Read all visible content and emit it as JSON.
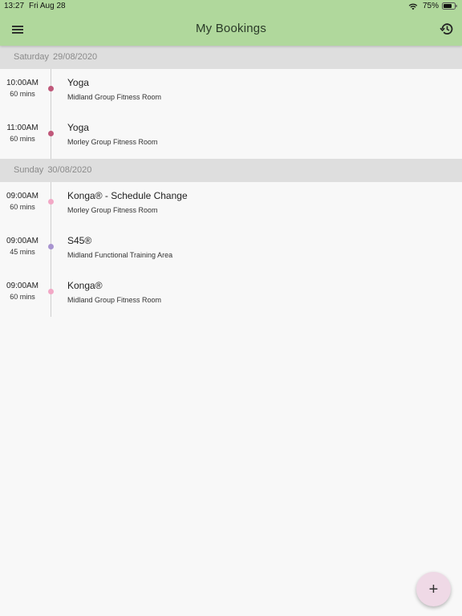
{
  "status_bar": {
    "time": "13:27",
    "date": "Fri Aug 28",
    "battery": "75%",
    "wifi_icon": "wifi-icon",
    "battery_icon": "battery-icon"
  },
  "header": {
    "title": "My Bookings",
    "menu_icon": "hamburger-menu-icon",
    "history_icon": "history-icon",
    "background": "#b0d89c"
  },
  "days": [
    {
      "weekday": "Saturday",
      "date": "29/08/2020",
      "bookings": [
        {
          "time": "10:00AM",
          "duration": "60 mins",
          "name": "Yoga",
          "location": "Midland Group Fitness Room",
          "dot_color": "#c0587a"
        },
        {
          "time": "11:00AM",
          "duration": "60 mins",
          "name": "Yoga",
          "location": "Morley Group Fitness Room",
          "dot_color": "#c0587a"
        }
      ]
    },
    {
      "weekday": "Sunday",
      "date": "30/08/2020",
      "bookings": [
        {
          "time": "09:00AM",
          "duration": "60 mins",
          "name": "Konga® - Schedule Change",
          "location": "Morley Group Fitness Room",
          "dot_color": "#f2a8c6"
        },
        {
          "time": "09:00AM",
          "duration": "45 mins",
          "name": "S45®",
          "location": "Midland Functional Training Area",
          "dot_color": "#a894d0"
        },
        {
          "time": "09:00AM",
          "duration": "60 mins",
          "name": "Konga®",
          "location": "Midland Group Fitness Room",
          "dot_color": "#f2a8c6"
        }
      ]
    }
  ],
  "fab": {
    "label": "+",
    "icon": "plus-icon",
    "background": "#efd9e6"
  }
}
